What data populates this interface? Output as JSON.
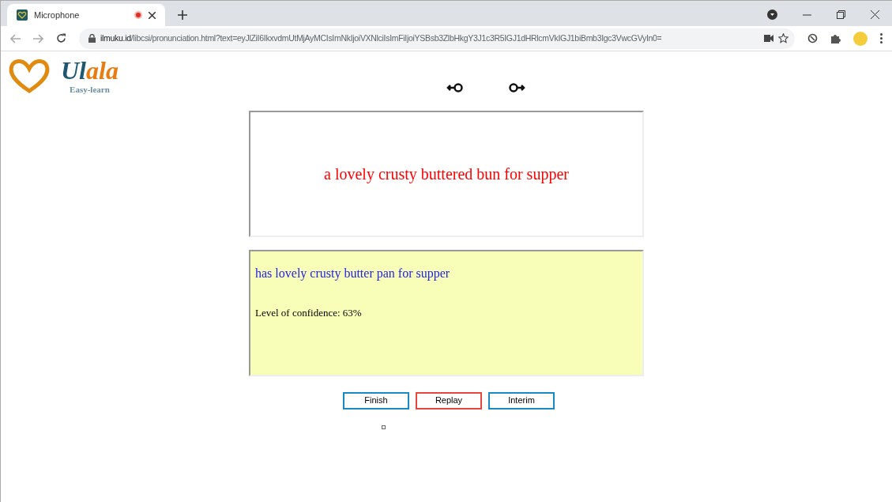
{
  "browser": {
    "tab": {
      "title": "Microphone",
      "recording": true
    },
    "url_host": "ilmuku.id",
    "url_path": "/libcsi/pronunciation.html?text=eyJlZiI6IkxvdmUtMjAyMCIsImNkIjoiVXNlciIsImFiIjoiYSBsb3ZlbHkgY3J1c3R5IGJ1dHRlcmVkIGJ1biBmb3Igc3VwcGVyIn0="
  },
  "logo": {
    "wordmark_dark": "Ul",
    "wordmark_accent": "ala",
    "tagline": "Easy-learn"
  },
  "target_sentence": "a lovely crusty buttered bun for supper",
  "result": {
    "heard": "has lovely crusty butter pan for supper",
    "confidence": "Level of confidence: 63%"
  },
  "buttons": [
    {
      "label": "Finish",
      "color": "#1a8ac4"
    },
    {
      "label": "Replay",
      "color": "#e8463c"
    },
    {
      "label": "Interim",
      "color": "#1a8ac4"
    }
  ],
  "checkbox": {
    "checked": false
  }
}
